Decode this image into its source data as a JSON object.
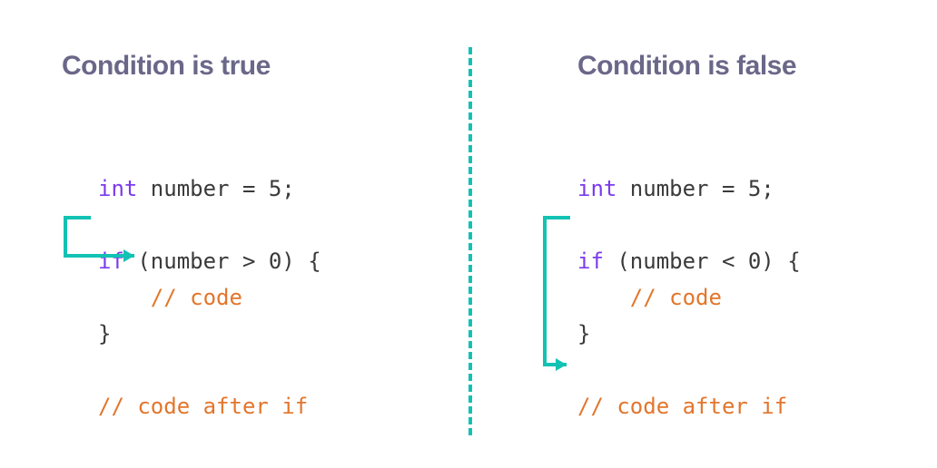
{
  "left": {
    "title": "Condition is true",
    "code": {
      "l1a": "int",
      "l1b": " number = 5;",
      "l2a": "if",
      "l2b": " (number > 0) {",
      "l3": "    // code",
      "l4": "}",
      "l5": "// code after if"
    }
  },
  "right": {
    "title": "Condition is false",
    "code": {
      "l1a": "int",
      "l1b": " number = 5;",
      "l2a": "if",
      "l2b": " (number < 0) {",
      "l3": "    // code",
      "l4": "}",
      "l5": "// code after if"
    }
  }
}
